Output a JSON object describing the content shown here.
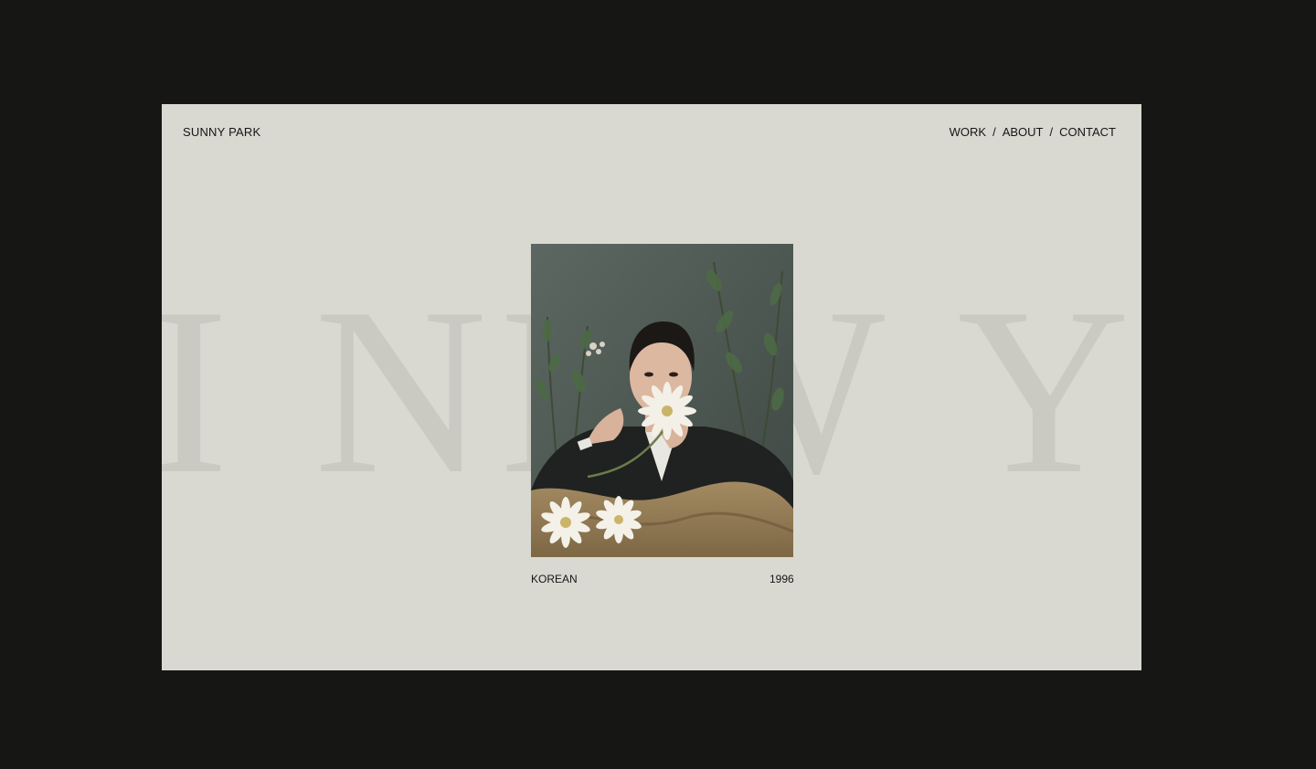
{
  "brand": {
    "name": "SUNNY PARK"
  },
  "nav": {
    "items": [
      {
        "label": "WORK"
      },
      {
        "label": "ABOUT"
      },
      {
        "label": "CONTACT"
      }
    ],
    "separator": "/"
  },
  "hero": {
    "background_word": "I NEW YOR"
  },
  "feature": {
    "caption_left": "KOREAN",
    "caption_right": "1996"
  },
  "colors": {
    "page_background": "#161614",
    "card_background": "#d9d9d2",
    "background_word": "#cacac3",
    "text": "#151515"
  }
}
